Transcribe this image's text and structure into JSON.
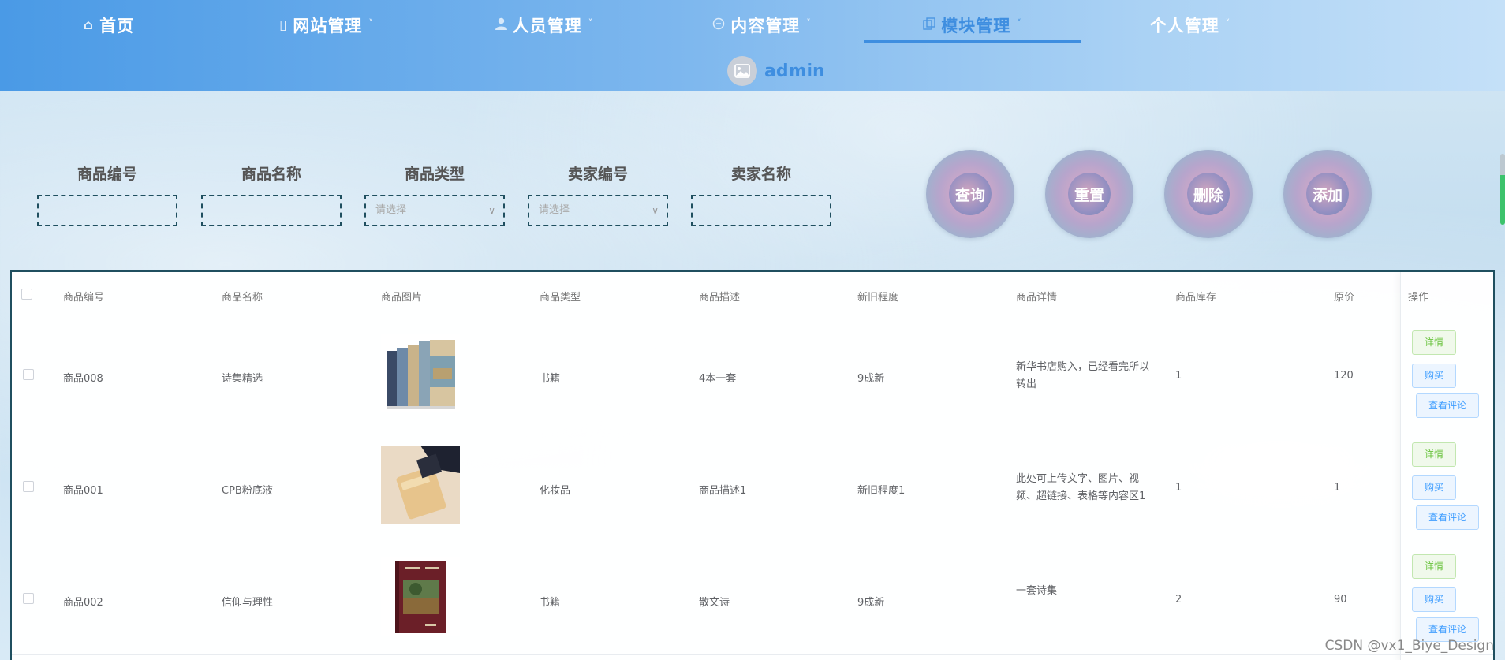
{
  "header": {
    "nav": [
      {
        "label": "首页",
        "icon": "home-icon",
        "has_dropdown": false,
        "active": false
      },
      {
        "label": "网站管理",
        "icon": "document-icon",
        "has_dropdown": true,
        "active": false
      },
      {
        "label": "人员管理",
        "icon": "person-icon",
        "has_dropdown": true,
        "active": false
      },
      {
        "label": "内容管理",
        "icon": "chat-icon",
        "has_dropdown": true,
        "active": false
      },
      {
        "label": "模块管理",
        "icon": "copy-icon",
        "has_dropdown": true,
        "active": true
      },
      {
        "label": "个人管理",
        "icon": "",
        "has_dropdown": true,
        "active": false
      }
    ],
    "user": {
      "name": "admin",
      "avatar_icon": "image-icon"
    }
  },
  "search": {
    "fields": [
      {
        "label": "商品编号",
        "type": "input",
        "value": "",
        "placeholder": ""
      },
      {
        "label": "商品名称",
        "type": "input",
        "value": "",
        "placeholder": ""
      },
      {
        "label": "商品类型",
        "type": "select",
        "value": "",
        "placeholder": "请选择"
      },
      {
        "label": "卖家编号",
        "type": "select",
        "value": "",
        "placeholder": "请选择"
      },
      {
        "label": "卖家名称",
        "type": "input",
        "value": "",
        "placeholder": ""
      }
    ],
    "buttons": {
      "query": "查询",
      "reset": "重置",
      "delete": "删除",
      "add": "添加"
    }
  },
  "table": {
    "columns": [
      "商品编号",
      "商品名称",
      "商品图片",
      "商品类型",
      "商品描述",
      "新旧程度",
      "商品详情",
      "商品库存",
      "原价",
      "操作"
    ],
    "rows": [
      {
        "id": "商品008",
        "name": "诗集精选",
        "image": "book-set-image",
        "type": "书籍",
        "desc": "4本一套",
        "condition": "9成新",
        "detail": "新华书店购入，已经看完所以转出",
        "stock": "1",
        "price": "120"
      },
      {
        "id": "商品001",
        "name": "CPB粉底液",
        "image": "foundation-bottle-image",
        "type": "化妆品",
        "desc": "商品描述1",
        "condition": "新旧程度1",
        "detail": "此处可上传文字、图片、视频、超链接、表格等内容区1",
        "stock": "1",
        "price": "1"
      },
      {
        "id": "商品002",
        "name": "信仰与理性",
        "image": "red-book-image",
        "type": "书籍",
        "desc": "散文诗",
        "condition": "9成新",
        "detail": "一套诗集",
        "stock": "2",
        "price": "90"
      }
    ],
    "actions": {
      "detail": "详情",
      "buy": "购买",
      "review": "查看评论"
    }
  },
  "watermark": "CSDN @vx1_Biye_Design",
  "colors": {
    "accent": "#3e8ee0",
    "border": "#1f4f5f",
    "success": "#67c23a",
    "primary": "#409eff"
  }
}
